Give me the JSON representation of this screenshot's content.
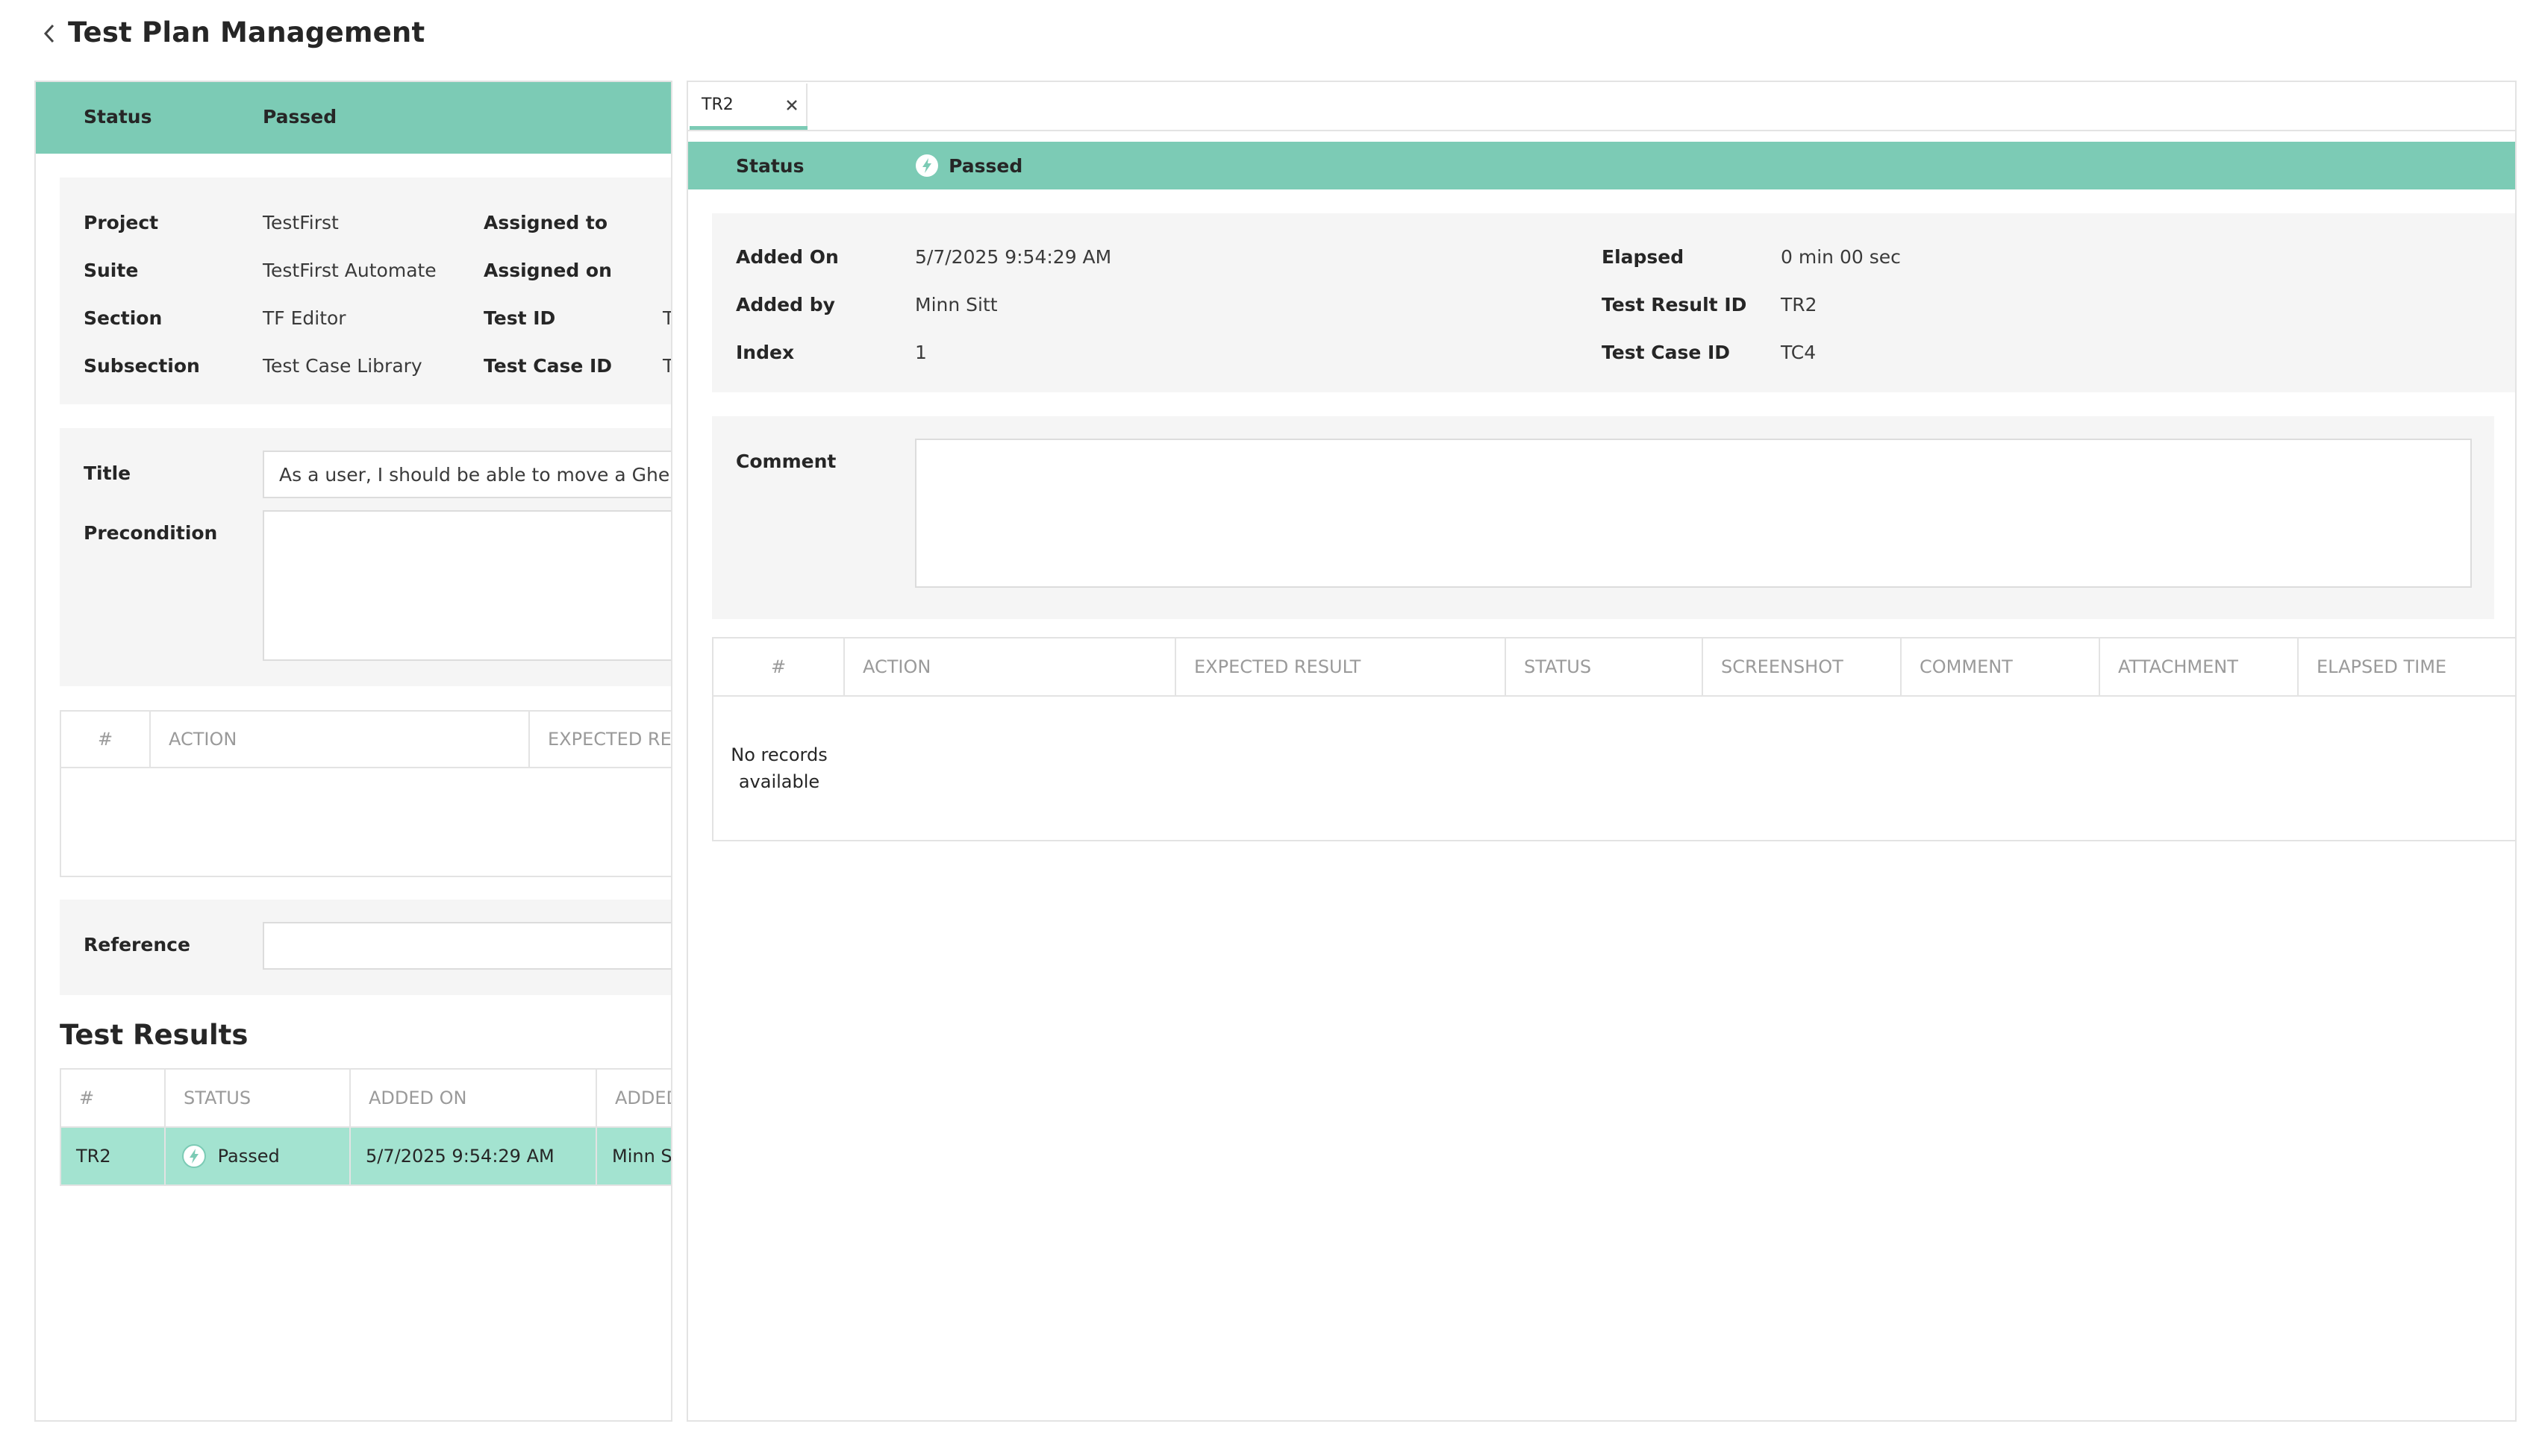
{
  "header": {
    "title": "Test Plan Management"
  },
  "left": {
    "status_label": "Status",
    "status_value": "Passed",
    "details": {
      "project_label": "Project",
      "project_value": "TestFirst",
      "suite_label": "Suite",
      "suite_value": "TestFirst Automate",
      "section_label": "Section",
      "section_value": "TF Editor",
      "subsection_label": "Subsection",
      "subsection_value": "Test Case Library",
      "assigned_to_label": "Assigned to",
      "assigned_on_label": "Assigned on",
      "test_id_label": "Test ID",
      "test_id_value": "T",
      "test_case_id_label": "Test Case ID",
      "test_case_id_value": "T"
    },
    "title_label": "Title",
    "title_value": "As a user, I should be able to move a Gherkin",
    "precondition_label": "Precondition",
    "precondition_value": "",
    "steps_headers": [
      "#",
      "ACTION",
      "EXPECTED RE"
    ],
    "reference_label": "Reference",
    "reference_value": "",
    "results_title": "Test Results",
    "results_headers": [
      "#",
      "STATUS",
      "ADDED ON",
      "ADDED"
    ],
    "results_rows": [
      {
        "id": "TR2",
        "status": "Passed",
        "added_on": "5/7/2025 9:54:29 AM",
        "added_by": "Minn Sit"
      }
    ]
  },
  "right": {
    "tab_label": "TR2",
    "status_label": "Status",
    "status_value": "Passed",
    "details": {
      "added_on_label": "Added On",
      "added_on_value": "5/7/2025 9:54:29 AM",
      "added_by_label": "Added by",
      "added_by_value": "Minn Sitt",
      "index_label": "Index",
      "index_value": "1",
      "elapsed_label": "Elapsed",
      "elapsed_value": "0 min 00 sec",
      "test_result_id_label": "Test Result ID",
      "test_result_id_value": "TR2",
      "test_case_id_label": "Test Case ID",
      "test_case_id_value": "TC4"
    },
    "comment_label": "Comment",
    "comment_value": "",
    "steps_headers": [
      "#",
      "ACTION",
      "EXPECTED RESULT",
      "STATUS",
      "SCREENSHOT",
      "COMMENT",
      "ATTACHMENT",
      "ELAPSED TIME"
    ],
    "no_records_line1": "No records",
    "no_records_line2": "available"
  },
  "colors": {
    "accent": "#7ccbb5",
    "row_highlight": "#a3e3d0",
    "card_bg": "#f5f5f5",
    "border": "#e3e3e3"
  },
  "icons": {
    "back": "chevron-left-icon",
    "close": "close-icon",
    "status": "lightning-icon"
  }
}
